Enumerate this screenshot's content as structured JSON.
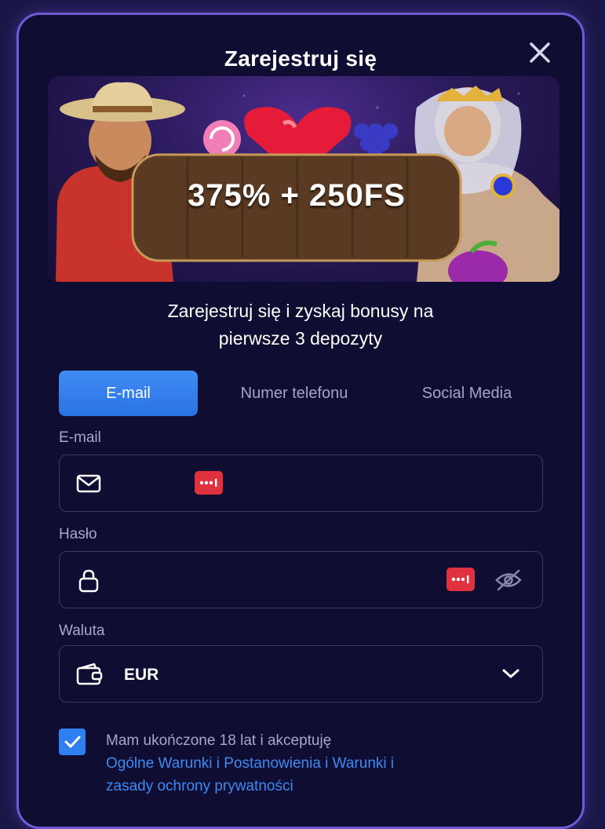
{
  "modal": {
    "title": "Zarejestruj się",
    "close_icon": "close-icon"
  },
  "banner": {
    "offer": "375% + 250FS"
  },
  "promo": {
    "line1": "Zarejestruj się i zyskaj bonusy na",
    "line2": "pierwsze 3 depozyty"
  },
  "tabs": [
    {
      "label": "E-mail",
      "active": true
    },
    {
      "label": "Numer telefonu",
      "active": false
    },
    {
      "label": "Social Media",
      "active": false
    }
  ],
  "form": {
    "email": {
      "label": "E-mail",
      "value": "",
      "icon": "mail-icon"
    },
    "password": {
      "label": "Hasło",
      "value": "",
      "icon": "lock-icon",
      "toggle_icon": "eye-off-icon"
    },
    "currency": {
      "label": "Waluta",
      "value": "EUR",
      "icon": "wallet-icon",
      "dropdown_icon": "chevron-down-icon"
    }
  },
  "terms": {
    "checked": true,
    "text": "Mam ukończone 18 lat i akceptuję",
    "link1": "Ogólne Warunki i Postanowienia",
    "separator": " i ",
    "link2a": "Warunki i",
    "link2b": "zasady ochrony prywatności"
  },
  "colors": {
    "background": "#1a1748",
    "modal": "#100d33",
    "border": "#6f5bd8",
    "accent": "#2f7ff0",
    "badge": "#e0323e"
  }
}
